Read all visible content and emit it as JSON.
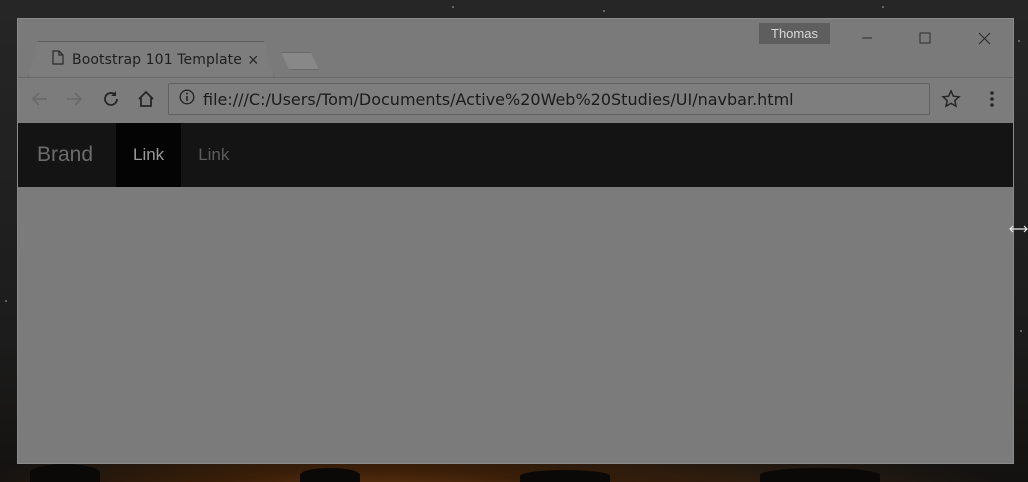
{
  "browser": {
    "profile_name": "Thomas",
    "tab": {
      "title": "Bootstrap 101 Template",
      "close_glyph": "×"
    },
    "address_bar": {
      "url": "file:///C:/Users/Tom/Documents/Active%20Web%20Studies/UI/navbar.html"
    },
    "icons": [
      "back-arrow-icon",
      "forward-arrow-icon",
      "reload-icon",
      "home-icon",
      "info-icon",
      "star-icon",
      "menu-dots-icon",
      "minimize-icon",
      "maximize-icon",
      "close-icon",
      "page-icon"
    ]
  },
  "page": {
    "navbar": {
      "brand": "Brand",
      "links": [
        {
          "label": "Link",
          "active": true
        },
        {
          "label": "Link",
          "active": false
        }
      ]
    }
  },
  "colors": {
    "overlay_gray": "#7b7b7b",
    "navbar_bg": "#141414",
    "active_link_bg": "#040404"
  }
}
